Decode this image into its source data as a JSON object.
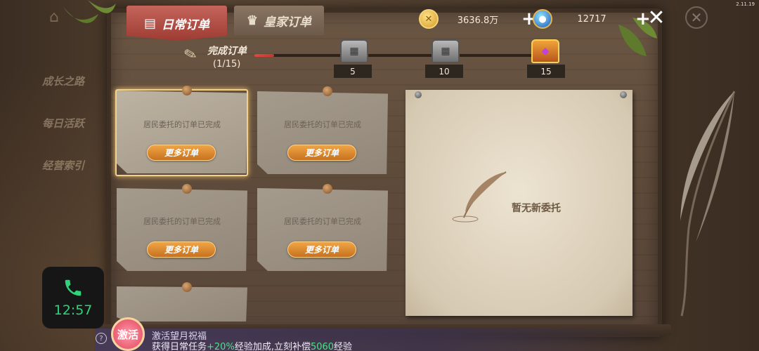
{
  "version": "2.11.19",
  "side_menu": [
    "成长之路",
    "每日活跃",
    "经营索引"
  ],
  "tabs": [
    {
      "label": "日常订单",
      "active": true
    },
    {
      "label": "皇家订单",
      "active": false
    }
  ],
  "currency": {
    "gold": "3636.8万",
    "gems": "12717"
  },
  "progress": {
    "label": "完成订单",
    "count": "(1/15)",
    "fraction": 0.067,
    "milestones": [
      "5",
      "10",
      "15"
    ]
  },
  "orders": [
    {
      "text": "居民委托的订单已完成",
      "button": "更多订单"
    },
    {
      "text": "居民委托的订单已完成",
      "button": "更多订单"
    },
    {
      "text": "居民委托的订单已完成",
      "button": "更多订单"
    },
    {
      "text": "居民委托的订单已完成",
      "button": "更多订单"
    }
  ],
  "empty_state": "暂无新委托",
  "call": {
    "time": "12:57"
  },
  "banner": {
    "badge": "激活",
    "title": "激活望月祝福",
    "line2_prefix": "获得日常任务",
    "line2_bonus": "+20%",
    "line2_mid": "经验加成,立刻补偿",
    "line2_exp": "5060",
    "line2_suffix": "经验"
  },
  "colors": {
    "active_tab": "#b04a40",
    "button": "#e08a30",
    "progress_fill": "#e04a3e",
    "call_green": "#2fd37a"
  }
}
